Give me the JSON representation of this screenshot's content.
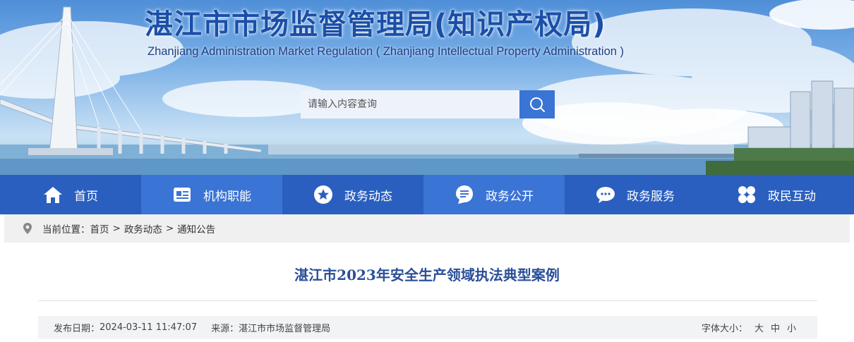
{
  "header": {
    "title": "湛江市市场监督管理局(知识产权局)",
    "subtitle": "Zhanjiang Administration Market Regulation ( Zhanjiang Intellectual Property Administration )"
  },
  "search": {
    "placeholder": "请输入内容查询",
    "icon": "search-icon"
  },
  "nav": {
    "items": [
      {
        "label": "首页",
        "icon": "home-icon"
      },
      {
        "label": "机构职能",
        "icon": "id-card-icon"
      },
      {
        "label": "政务动态",
        "icon": "star-icon"
      },
      {
        "label": "政务公开",
        "icon": "document-icon"
      },
      {
        "label": "政务服务",
        "icon": "chat-bubble-icon"
      },
      {
        "label": "政民互动",
        "icon": "clover-icon"
      }
    ],
    "active_label": "政务动态"
  },
  "breadcrumb": {
    "prefix": "当前位置：",
    "items": [
      "首页",
      "政务动态",
      "通知公告"
    ],
    "separator": ">"
  },
  "article": {
    "title": "湛江市2023年安全生产领域执法典型案例",
    "publish_label": "发布日期：",
    "publish_date": "2024-03-11 11:47:07",
    "source_label": "来源：",
    "source": "湛江市市场监督管理局",
    "fontsize_label": "字体大小：",
    "fontsize_options": [
      "大",
      "中",
      "小"
    ]
  },
  "colors": {
    "nav_bg": "#2a5fbf",
    "nav_active": "#3a74d4",
    "title_blue": "#1a4fa8",
    "article_title": "#2a4f99"
  }
}
